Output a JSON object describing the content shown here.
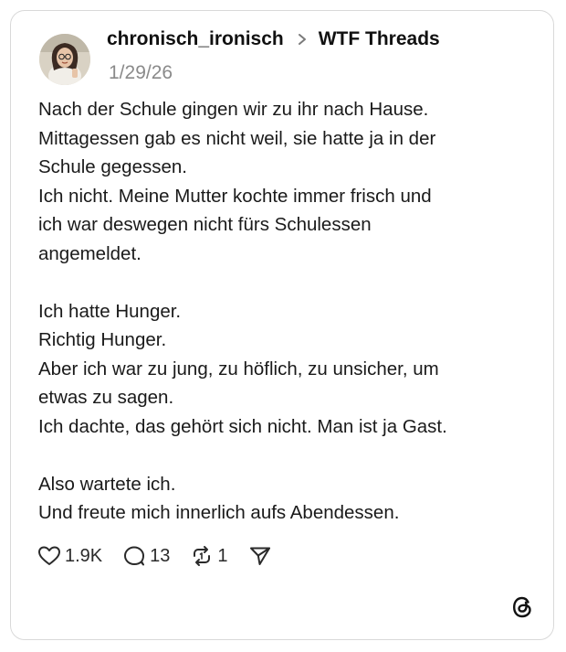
{
  "post": {
    "author": "chronisch_ironisch",
    "community": "WTF Threads",
    "date": "1/29/26",
    "paragraphs": [
      [
        "Nach der Schule gingen wir zu ihr nach Hause.",
        "Mittagessen gab es nicht weil, sie hatte ja in der",
        "Schule gegessen.",
        "Ich nicht. Meine Mutter kochte immer frisch und",
        "ich war deswegen nicht fürs Schulessen",
        "angemeldet."
      ],
      [
        "Ich hatte Hunger.",
        "Richtig Hunger.",
        "Aber ich war zu jung, zu höflich, zu unsicher, um",
        "etwas zu sagen.",
        "Ich dachte, das gehört sich nicht. Man ist ja Gast."
      ],
      [
        "Also wartete ich.",
        "Und freute mich innerlich aufs Abendessen."
      ]
    ]
  },
  "actions": {
    "likes": "1.9K",
    "replies": "13",
    "reposts": "1"
  },
  "icons": {
    "avatar": "avatar-photo",
    "chevron": "chevron-right-icon",
    "like": "heart-icon",
    "reply": "comment-bubble-icon",
    "repost": "repost-icon",
    "share": "send-icon",
    "brand": "threads-logo-icon"
  },
  "colors": {
    "text": "#1a1a1a",
    "muted": "#8a8a8a",
    "border": "#d9d9d9"
  }
}
